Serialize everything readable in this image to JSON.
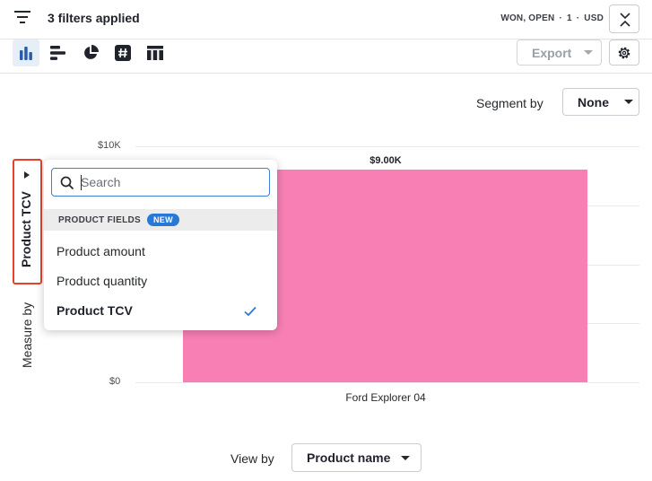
{
  "header": {
    "filter_text": "3 filters applied",
    "summary": [
      "WON, OPEN",
      "1",
      "USD"
    ],
    "summary_separator": "·"
  },
  "toolbar": {
    "views": [
      {
        "icon": "column-chart-icon",
        "active": true
      },
      {
        "icon": "bar-chart-icon",
        "active": false
      },
      {
        "icon": "pie-chart-icon",
        "active": false
      },
      {
        "icon": "scorecard-icon",
        "active": false
      },
      {
        "icon": "table-icon",
        "active": false
      }
    ],
    "export_label": "Export",
    "settings_icon": "gear-icon"
  },
  "segment": {
    "label": "Segment by",
    "value": "None"
  },
  "measure": {
    "label": "Measure by",
    "value": "Product TCV"
  },
  "dropdown": {
    "search_placeholder": "Search",
    "section_label": "PRODUCT FIELDS",
    "badge": "NEW",
    "options": [
      {
        "label": "Product amount",
        "selected": false
      },
      {
        "label": "Product quantity",
        "selected": false
      },
      {
        "label": "Product TCV",
        "selected": true
      }
    ]
  },
  "view_by": {
    "label": "View by",
    "value": "Product name"
  },
  "chart_data": {
    "type": "bar",
    "categories": [
      "Ford Explorer 04"
    ],
    "values": [
      9000
    ],
    "data_labels": [
      "$9.00K"
    ],
    "y_ticks": [
      "$10K",
      "$0"
    ],
    "ylim": [
      0,
      10000
    ],
    "grid": true,
    "bar_color": "#f77fb4"
  },
  "colors": {
    "accent": "#2a78d6",
    "highlight_border": "#e8402b"
  }
}
